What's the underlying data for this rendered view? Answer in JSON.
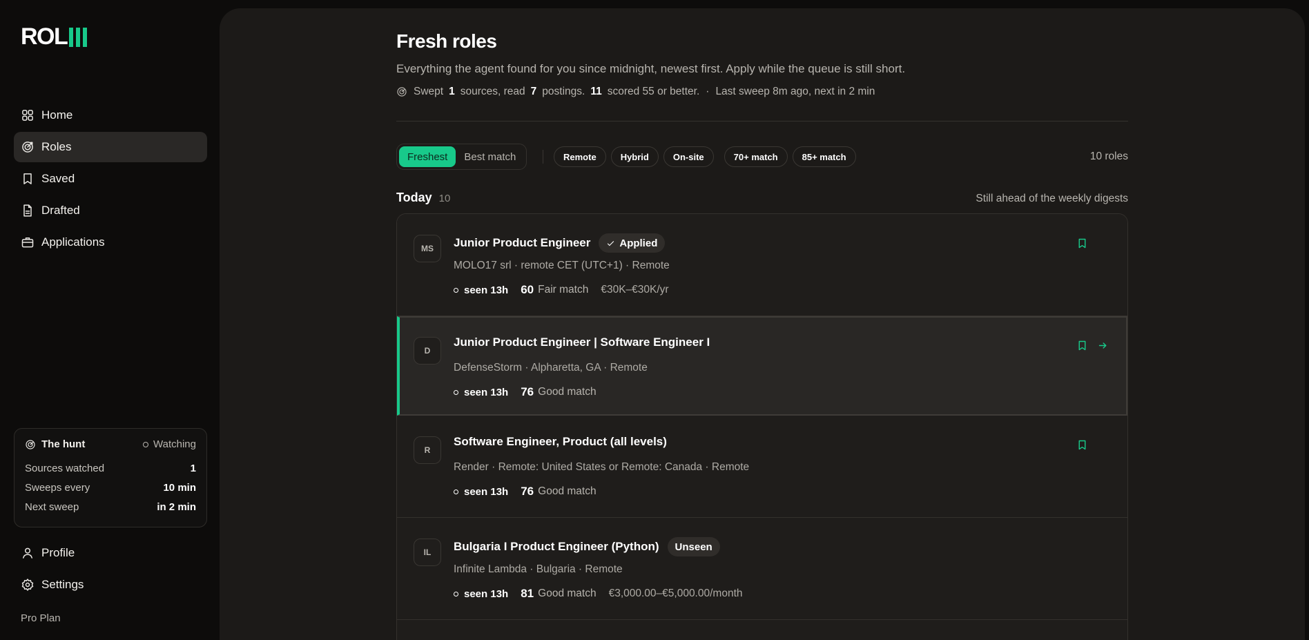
{
  "brand": {
    "word": "ROL",
    "accent": "#18c98a"
  },
  "nav": {
    "home": "Home",
    "roles": "Roles",
    "saved": "Saved",
    "drafted": "Drafted",
    "applications": "Applications",
    "profile": "Profile",
    "settings": "Settings"
  },
  "hunt": {
    "title": "The hunt",
    "status": "Watching",
    "rows": [
      {
        "label": "Sources watched",
        "value": "1"
      },
      {
        "label": "Sweeps every",
        "value": "10 min"
      },
      {
        "label": "Next sweep",
        "value": "in 2 min"
      }
    ]
  },
  "plan": "Pro Plan",
  "page": {
    "title": "Fresh roles",
    "subtitle": "Everything the agent found for you since midnight, newest first. Apply while the queue is still short.",
    "stats": {
      "swept_prefix": "Swept",
      "sources": "1",
      "sources_label": "sources, read",
      "postings": "7",
      "postings_label": "postings.",
      "scored": "11",
      "scored_label": "scored 55 or better.",
      "separator": "·",
      "last_sweep": "Last sweep 8m ago, next in 2 min"
    }
  },
  "toolbar": {
    "sort": [
      "Freshest",
      "Best match"
    ],
    "filters": [
      "Remote",
      "Hybrid",
      "On-site"
    ],
    "match_filters": [
      "70+ match",
      "85+ match"
    ],
    "count": "10 roles"
  },
  "group": {
    "title": "Today",
    "count": "10",
    "note": "Still ahead of the weekly digests"
  },
  "roles": [
    {
      "initials": "MS",
      "title": "Junior Product Engineer",
      "badge": "Applied",
      "subtitle": "MOLO17 srl · remote CET (UTC+1) · Remote",
      "seen": "seen 13h",
      "score": "60",
      "match": "Fair match",
      "salary": "€30K–€30K/yr"
    },
    {
      "initials": "D",
      "title": "Junior Product Engineer | Software Engineer I",
      "badge": "",
      "subtitle": "DefenseStorm · Alpharetta, GA · Remote",
      "seen": "seen 13h",
      "score": "76",
      "match": "Good match",
      "salary": ""
    },
    {
      "initials": "R",
      "title": "Software Engineer, Product (all levels)",
      "badge": "",
      "subtitle": "Render · Remote: United States or Remote: Canada · Remote",
      "seen": "seen 13h",
      "score": "76",
      "match": "Good match",
      "salary": ""
    },
    {
      "initials": "IL",
      "title": "Bulgaria I Product Engineer (Python)",
      "badge": "Unseen",
      "subtitle": "Infinite Lambda · Bulgaria · Remote",
      "seen": "seen 13h",
      "score": "81",
      "match": "Good match",
      "salary": "€3,000.00–€5,000.00/month"
    }
  ]
}
